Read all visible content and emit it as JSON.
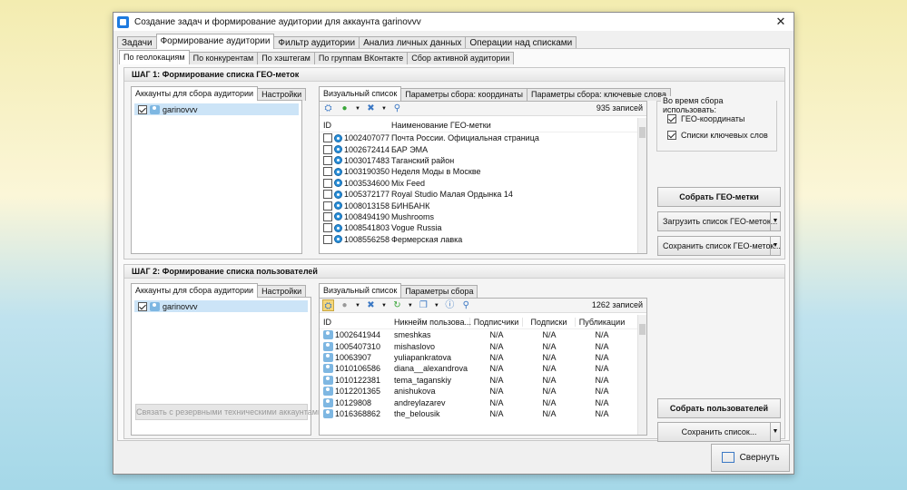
{
  "window": {
    "title": "Создание задач и формирование аудитории для аккаунта garinovvv",
    "close": "✕"
  },
  "main_tabs": [
    "Задачи",
    "Формирование аудитории",
    "Фильтр аудитории",
    "Анализ личных данных",
    "Операции над списками"
  ],
  "sub_tabs": [
    "По геолокациям",
    "По конкурентам",
    "По хэштегам",
    "По группам ВКонтакте",
    "Сбор активной аудитории"
  ],
  "step1": {
    "title": "ШАГ 1: Формирование списка ГЕО-меток",
    "left_tabs": [
      "Аккаунты для сбора аудитории",
      "Настройки"
    ],
    "account": "garinovvv",
    "right_tabs": [
      "Визуальный список",
      "Параметры сбора: координаты",
      "Параметры сбора: ключевые слова"
    ],
    "count": "935 записей",
    "col_id": "ID",
    "col_name": "Наименование ГЕО-метки",
    "rows": [
      [
        "1002407077",
        "Почта России. Официальная страница"
      ],
      [
        "1002672414",
        "БАР ЭМА"
      ],
      [
        "1003017483",
        "Таганский район"
      ],
      [
        "1003190350",
        "Неделя Моды в Москве"
      ],
      [
        "1003534600",
        "Mix Feed"
      ],
      [
        "1005372177",
        "Royal Studio Малая Ордынка 14"
      ],
      [
        "1008013158",
        "БИНБАНК"
      ],
      [
        "1008494190",
        "Mushrooms"
      ],
      [
        "1008541803",
        "Vogue Russia"
      ],
      [
        "1008556258",
        "Фермерская лавка"
      ]
    ],
    "options_title": "Во время сбора использовать:",
    "opt_geo": "ГЕО-координаты",
    "opt_kw": "Списки ключевых слов",
    "btn_collect": "Собрать ГЕО-метки",
    "btn_load": "Загрузить список ГЕО-меток...",
    "btn_save": "Сохранить список ГЕО-меток..."
  },
  "step2": {
    "title": "ШАГ 2: Формирование списка пользователей",
    "left_tabs": [
      "Аккаунты для сбора аудитории",
      "Настройки"
    ],
    "account": "garinovvv",
    "link_btn": "Связать с резервными техническими аккаунтами",
    "right_tabs": [
      "Визуальный список",
      "Параметры сбора"
    ],
    "count": "1262 записей",
    "cols": [
      "ID",
      "Никнейм пользова...",
      "Подписчики",
      "Подписки",
      "Публикации"
    ],
    "rows": [
      [
        "1002641944",
        "smeshkas",
        "N/A",
        "N/A",
        "N/A"
      ],
      [
        "1005407310",
        "mishaslovo",
        "N/A",
        "N/A",
        "N/A"
      ],
      [
        "10063907",
        "yuliapankratova",
        "N/A",
        "N/A",
        "N/A"
      ],
      [
        "1010106586",
        "diana__alexandrova",
        "N/A",
        "N/A",
        "N/A"
      ],
      [
        "1010122381",
        "tema_taganskiy",
        "N/A",
        "N/A",
        "N/A"
      ],
      [
        "1012201365",
        "anishukova",
        "N/A",
        "N/A",
        "N/A"
      ],
      [
        "10129808",
        "andreylazarev",
        "N/A",
        "N/A",
        "N/A"
      ],
      [
        "1016368862",
        "the_belousik",
        "N/A",
        "N/A",
        "N/A"
      ]
    ],
    "btn_collect": "Собрать пользователей",
    "btn_save": "Сохранить список..."
  },
  "footer": {
    "collapse": "Свернуть"
  }
}
